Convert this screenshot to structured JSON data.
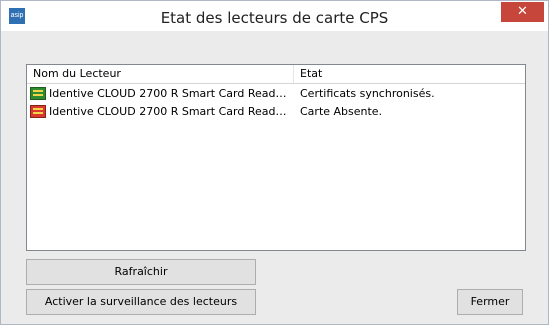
{
  "window": {
    "title": "Etat des lecteurs de carte CPS",
    "app_icon_text": "asip",
    "close_glyph": "✕"
  },
  "list": {
    "columns": [
      "Nom du Lecteur",
      "Etat"
    ],
    "rows": [
      {
        "name": "Identive CLOUD 2700 R Smart Card Read…",
        "state": "Certificats synchronisés.",
        "icon": "card-reader-green-icon",
        "icon_color": "#2e8b2e"
      },
      {
        "name": "Identive CLOUD 2700 R Smart Card Read…",
        "state": "Carte Absente.",
        "icon": "card-reader-red-icon",
        "icon_color": "#d9382c"
      }
    ]
  },
  "buttons": {
    "refresh": "Rafraîchir",
    "monitor": "Activer la surveillance des lecteurs",
    "close": "Fermer"
  }
}
